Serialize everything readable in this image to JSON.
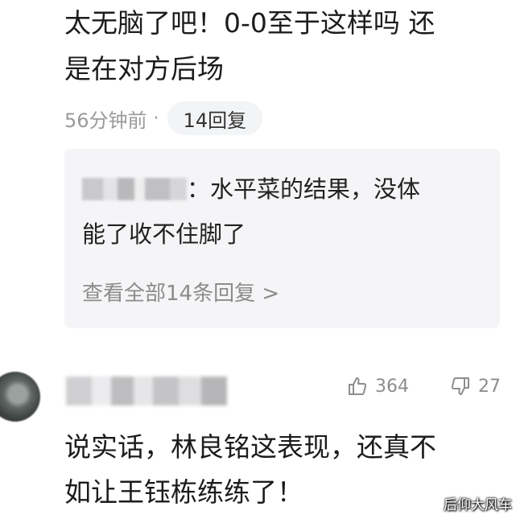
{
  "comment1": {
    "line1": "太无脑了吧！0-0至于这样吗 还",
    "line2": "是在对方后场",
    "time": "56分钟前",
    "separator": "·",
    "replies_button": "14回复"
  },
  "reply_preview": {
    "text_line1": "：水平菜的结果，没体",
    "text_line2": "能了收不住脚了",
    "view_all": "查看全部14条回复 >"
  },
  "comment2": {
    "likes": "364",
    "dislikes": "27",
    "line1": "说实话，林良铭这表现，还真不",
    "line2": "如让王钰栋练练了！",
    "icons": {
      "like": "thumbs-up-icon",
      "dislike": "thumbs-down-icon"
    }
  },
  "watermark": "后仰大风车",
  "colors": {
    "muted_text": "#9a9a9a",
    "pill_bg": "#f3f4f6",
    "reply_bg": "#f5f5f7"
  }
}
